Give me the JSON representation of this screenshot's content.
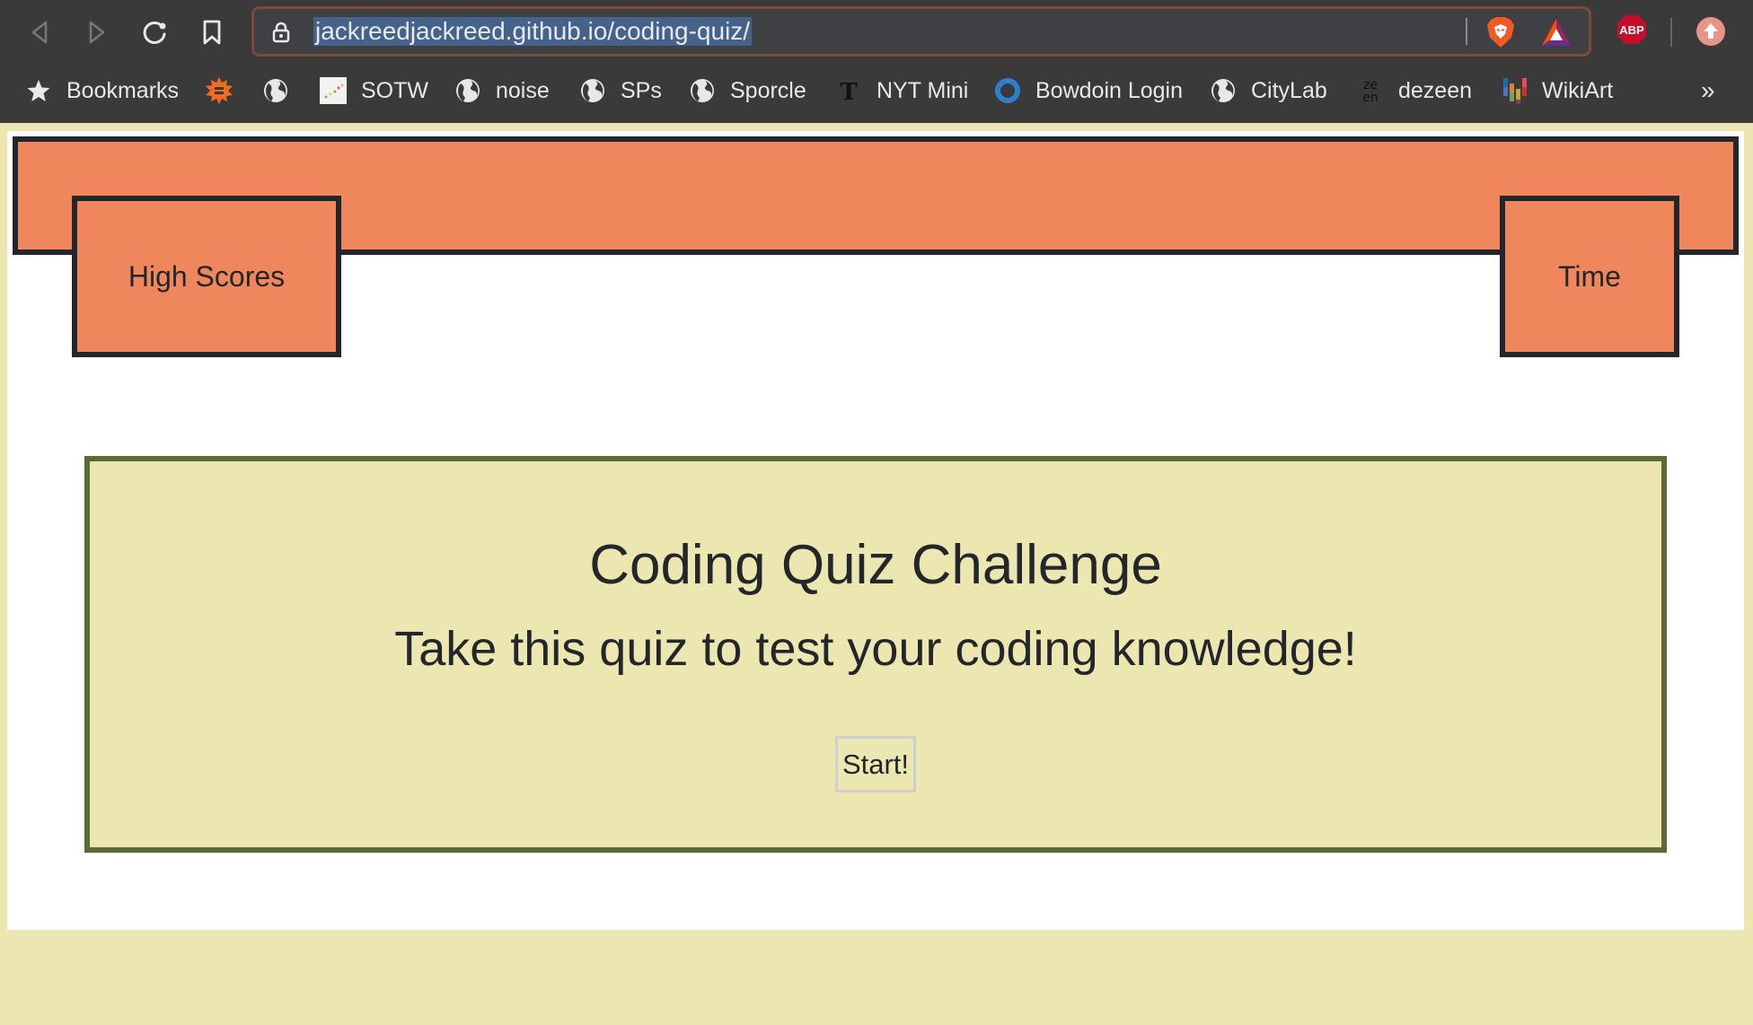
{
  "browser": {
    "url": "jackreedjackreed.github.io/coding-quiz/",
    "nav": {
      "back": "back-icon",
      "forward": "forward-icon",
      "reload": "reload-icon",
      "bookmark": "bookmark-icon"
    },
    "extensions": [
      "brave-shield-icon",
      "brave-rewards-icon",
      "adblock-plus-icon",
      "profile-icon"
    ],
    "extension_labels": {
      "abp": "ABP"
    },
    "bookmarks": [
      {
        "label": "Bookmarks",
        "icon": "star-icon"
      },
      {
        "label": "",
        "icon": "sun-badge-icon"
      },
      {
        "label": "",
        "icon": "globe-icon"
      },
      {
        "label": "SOTW",
        "icon": "dots-icon"
      },
      {
        "label": "noise",
        "icon": "globe-icon"
      },
      {
        "label": "SPs",
        "icon": "globe-icon"
      },
      {
        "label": "Sporcle",
        "icon": "globe-icon"
      },
      {
        "label": "NYT Mini",
        "icon": "nyt-icon"
      },
      {
        "label": "Bowdoin Login",
        "icon": "ring-icon"
      },
      {
        "label": "CityLab",
        "icon": "globe-icon"
      },
      {
        "label": "dezeen",
        "icon": "dezeen-icon"
      },
      {
        "label": "WikiArt",
        "icon": "wikiart-icon"
      }
    ],
    "more_label": "»"
  },
  "header": {
    "high_scores_label": "High Scores",
    "time_label": "Time"
  },
  "quiz": {
    "title": "Coding Quiz Challenge",
    "subtitle": "Take this quiz to test your coding knowledge!",
    "start_label": "Start!"
  },
  "colors": {
    "page_bg": "#ece7b0",
    "header_orange": "#f0865c",
    "border_dark": "#23262b",
    "quiz_border": "#5b6b36",
    "chrome_bg": "#3a3a3a"
  }
}
